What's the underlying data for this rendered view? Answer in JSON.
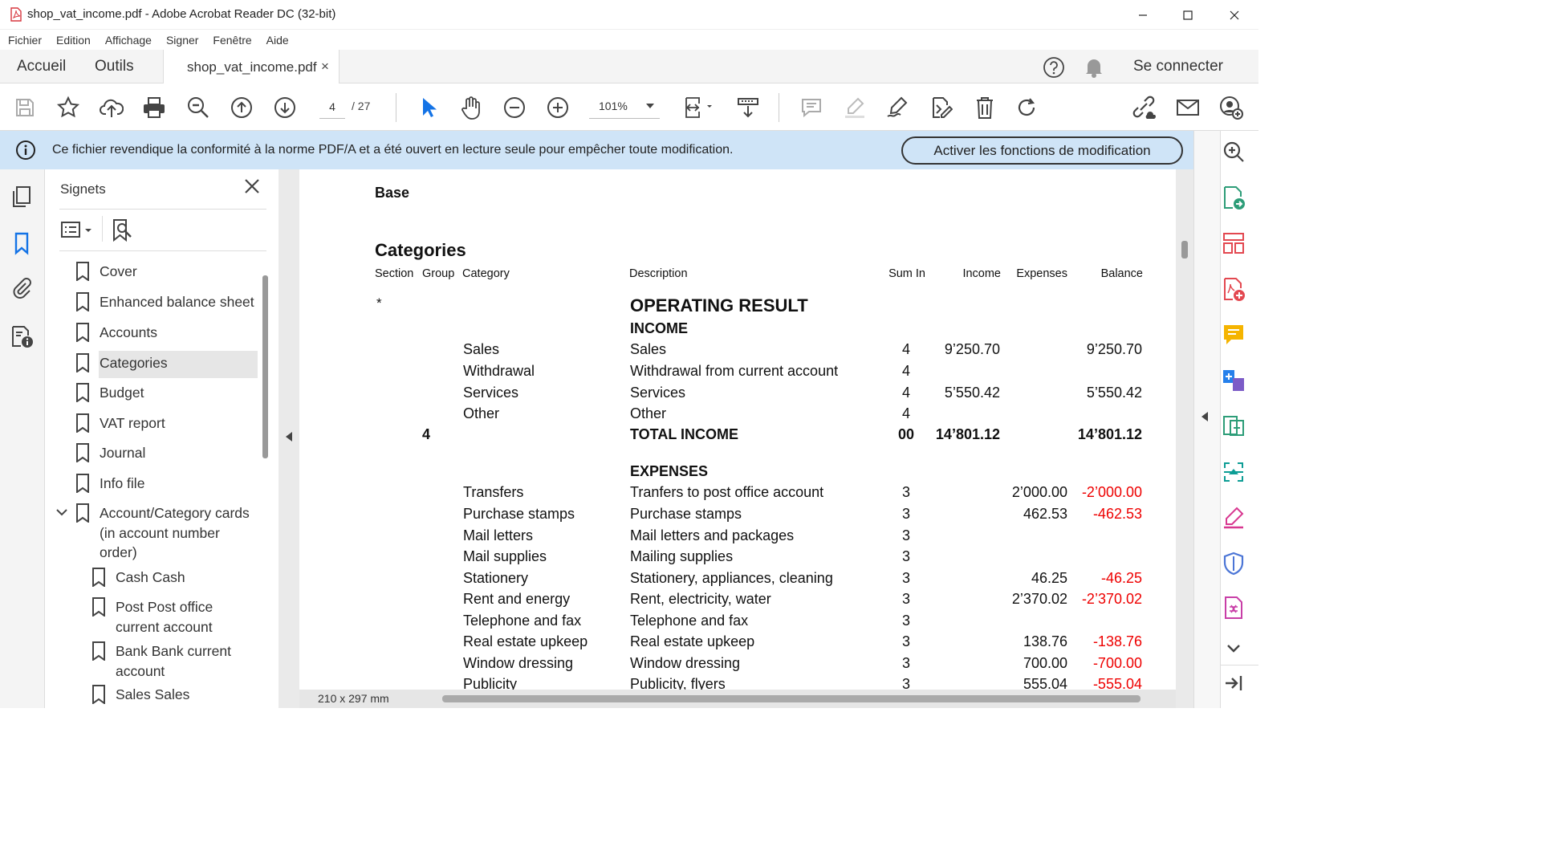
{
  "window": {
    "title": "shop_vat_income.pdf - Adobe Acrobat Reader DC (32-bit)"
  },
  "menu": [
    "Fichier",
    "Edition",
    "Affichage",
    "Signer",
    "Fenêtre",
    "Aide"
  ],
  "tabs": {
    "home": "Accueil",
    "tools": "Outils",
    "doc": "shop_vat_income.pdf",
    "doc_close": "×",
    "connect": "Se connecter"
  },
  "toolbar": {
    "page_current": "4",
    "page_total": "/  27",
    "zoom": "101%"
  },
  "banner": {
    "message": "Ce fichier revendique la conformité à la norme PDF/A et a été ouvert en lecture seule pour empêcher toute modification.",
    "button": "Activer les fonctions de modification"
  },
  "bookmarks": {
    "title": "Signets",
    "items": [
      {
        "label": "Cover"
      },
      {
        "label": "Enhanced balance sheet"
      },
      {
        "label": "Accounts"
      },
      {
        "label": "Categories",
        "selected": true
      },
      {
        "label": "Budget"
      },
      {
        "label": "VAT report"
      },
      {
        "label": "Journal"
      },
      {
        "label": "Info file"
      },
      {
        "label": "Account/Category cards (in account number order)",
        "expanded": true
      },
      {
        "label": "Cash Cash"
      },
      {
        "label": "Post Post office current account"
      },
      {
        "label": "Bank Bank current account"
      },
      {
        "label": "Sales Sales"
      }
    ]
  },
  "doc": {
    "base": "Base",
    "heading": "Categories",
    "columns": [
      "Section",
      "Group",
      "Category",
      "Description",
      "Sum In",
      "Income",
      "Expenses",
      "Balance"
    ],
    "star": "*",
    "operating": "OPERATING RESULT",
    "income_title": "INCOME",
    "income_rows": [
      {
        "category": "Sales",
        "description": "Sales",
        "sumin": "4",
        "income": "9’250.70",
        "expenses": "",
        "balance": "9’250.70"
      },
      {
        "category": "Withdrawal",
        "description": "Withdrawal from current account",
        "sumin": "4",
        "income": "",
        "expenses": "",
        "balance": ""
      },
      {
        "category": "Services",
        "description": "Services",
        "sumin": "4",
        "income": "5’550.42",
        "expenses": "",
        "balance": "5’550.42"
      },
      {
        "category": "Other",
        "description": "Other",
        "sumin": "4",
        "income": "",
        "expenses": "",
        "balance": ""
      }
    ],
    "total_income": {
      "group": "4",
      "description": "TOTAL INCOME",
      "sumin": "00",
      "income": "14’801.12",
      "balance": "14’801.12"
    },
    "expenses_title": "EXPENSES",
    "expense_rows": [
      {
        "category": "Transfers",
        "description": "Tranfers to post office account",
        "sumin": "3",
        "expenses": "2’000.00",
        "balance": "-2’000.00"
      },
      {
        "category": "Purchase stamps",
        "description": "Purchase stamps",
        "sumin": "3",
        "expenses": "462.53",
        "balance": "-462.53"
      },
      {
        "category": "Mail letters",
        "description": "Mail letters and packages",
        "sumin": "3",
        "expenses": "",
        "balance": ""
      },
      {
        "category": "Mail supplies",
        "description": "Mailing supplies",
        "sumin": "3",
        "expenses": "",
        "balance": ""
      },
      {
        "category": "Stationery",
        "description": "Stationery, appliances, cleaning",
        "sumin": "3",
        "expenses": "46.25",
        "balance": "-46.25"
      },
      {
        "category": "Rent and energy",
        "description": "Rent, electricity, water",
        "sumin": "3",
        "expenses": "2’370.02",
        "balance": "-2’370.02"
      },
      {
        "category": "Telephone and fax",
        "description": "Telephone and fax",
        "sumin": "3",
        "expenses": "",
        "balance": ""
      },
      {
        "category": "Real estate upkeep",
        "description": "Real estate upkeep",
        "sumin": "3",
        "expenses": "138.76",
        "balance": "-138.76"
      },
      {
        "category": "Window dressing",
        "description": "Window dressing",
        "sumin": "3",
        "expenses": "700.00",
        "balance": "-700.00"
      },
      {
        "category": "Publicity",
        "description": "Publicity, flyers",
        "sumin": "3",
        "expenses": "555.04",
        "balance": "-555.04"
      }
    ]
  },
  "status": {
    "page_size": "210 x 297 mm"
  },
  "colors": {
    "accent": "#1473e6",
    "banner": "#cfe4f7",
    "negative": "#e00000",
    "pdf_red": "#d7373f"
  }
}
